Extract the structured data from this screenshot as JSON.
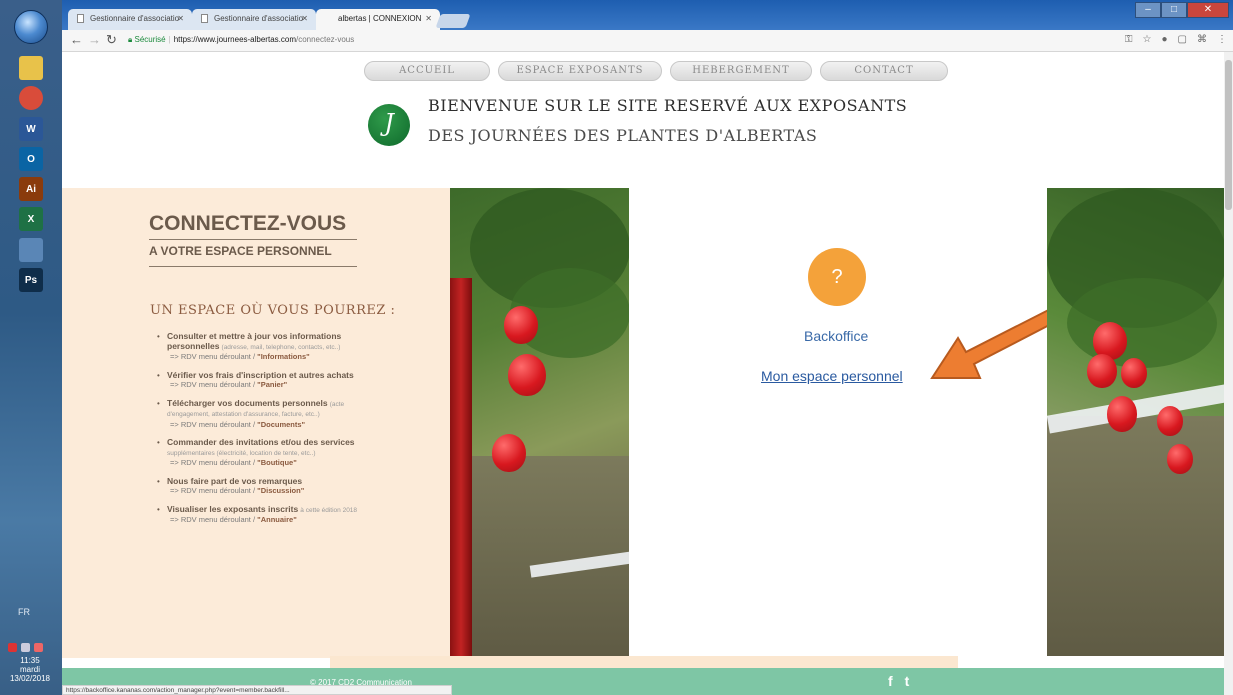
{
  "taskbar": {
    "apps": [
      {
        "name": "explorer-icon",
        "label": "",
        "color": "#e8c24a"
      },
      {
        "name": "chrome-icon",
        "label": "",
        "color": "#d94c3a"
      },
      {
        "name": "word-icon",
        "label": "W",
        "color": "#2b5797"
      },
      {
        "name": "outlook-icon",
        "label": "O",
        "color": "#0a64a4"
      },
      {
        "name": "illustrator-icon",
        "label": "Ai",
        "color": "#8a3b0c"
      },
      {
        "name": "excel-icon",
        "label": "X",
        "color": "#1e7145"
      },
      {
        "name": "app-icon",
        "label": "",
        "color": "#5a86b6"
      },
      {
        "name": "photoshop-icon",
        "label": "Ps",
        "color": "#0f2d4a"
      }
    ],
    "lang": "FR",
    "time": "11:35",
    "day": "mardi",
    "date": "13/02/2018"
  },
  "browser": {
    "tabs": [
      {
        "title": "Gestionnaire d'associatio",
        "active": false
      },
      {
        "title": "Gestionnaire d'associatio",
        "active": false
      },
      {
        "title": "albertas | CONNEXION",
        "active": true
      }
    ],
    "secure_label": "Sécurisé",
    "url_host": "https://www.journees-albertas.com",
    "url_path": "/connectez-vous",
    "status_url": "https://backoffice.kananas.com/action_manager.php?event=member.backfill..."
  },
  "site": {
    "nav": [
      "ACCUEIL",
      "ESPACE EXPOSANTS",
      "HEBERGEMENT",
      "CONTACT"
    ],
    "logo_letter": "J",
    "welcome_line1": "BIENVENUE SUR LE SITE RESERVÉ AUX EXPOSANTS",
    "welcome_line2": "DES JOURNÉES DES PLANTES D'ALBERTAS",
    "left": {
      "title": "CONNECTEZ-VOUS",
      "subtitle": "A VOTRE ESPACE PERSONNEL",
      "section": "UN ESPACE OÙ VOUS POURREZ :",
      "items": [
        {
          "title": "Consulter et mettre à jour vos informations personnelles",
          "small": "(adresse, mail, telephone, contacts, etc..)",
          "rdv": "=> RDV menu déroulant / ",
          "target": "\"Informations\""
        },
        {
          "title": "Vérifier vos frais d'inscription et autres achats",
          "small": "",
          "rdv": "=> RDV menu déroulant / ",
          "target": "\"Panier\""
        },
        {
          "title": "Télécharger vos documents personnels",
          "small": "(acte d'engagement, attestation d'assurance, facture, etc..)",
          "rdv": "=> RDV menu déroulant / ",
          "target": "\"Documents\""
        },
        {
          "title": "Commander des invitations et/ou des services",
          "small": "supplémentaires (électricité, location de tente, etc..)",
          "rdv": "=> RDV menu déroulant / ",
          "target": "\"Boutique\""
        },
        {
          "title": "Nous faire part de vos remarques",
          "small": "",
          "rdv": "=> RDV menu déroulant / ",
          "target": "\"Discussion\""
        },
        {
          "title": "Visualiser les exposants inscrits",
          "small": "à cette édition 2018",
          "rdv": "=> RDV menu déroulant / ",
          "target": "\"Annuaire\""
        }
      ]
    },
    "badge_symbol": "?",
    "backoffice_label": "Backoffice",
    "espace_link": "Mon espace personnel",
    "copyright": "© 2017 CD2 Communication",
    "social": [
      "f",
      "t"
    ],
    "colors": {
      "accent": "#f4a23a",
      "arrow": "#ed7d31",
      "footer": "#7ec6a5",
      "panel": "#fcebd9"
    }
  }
}
